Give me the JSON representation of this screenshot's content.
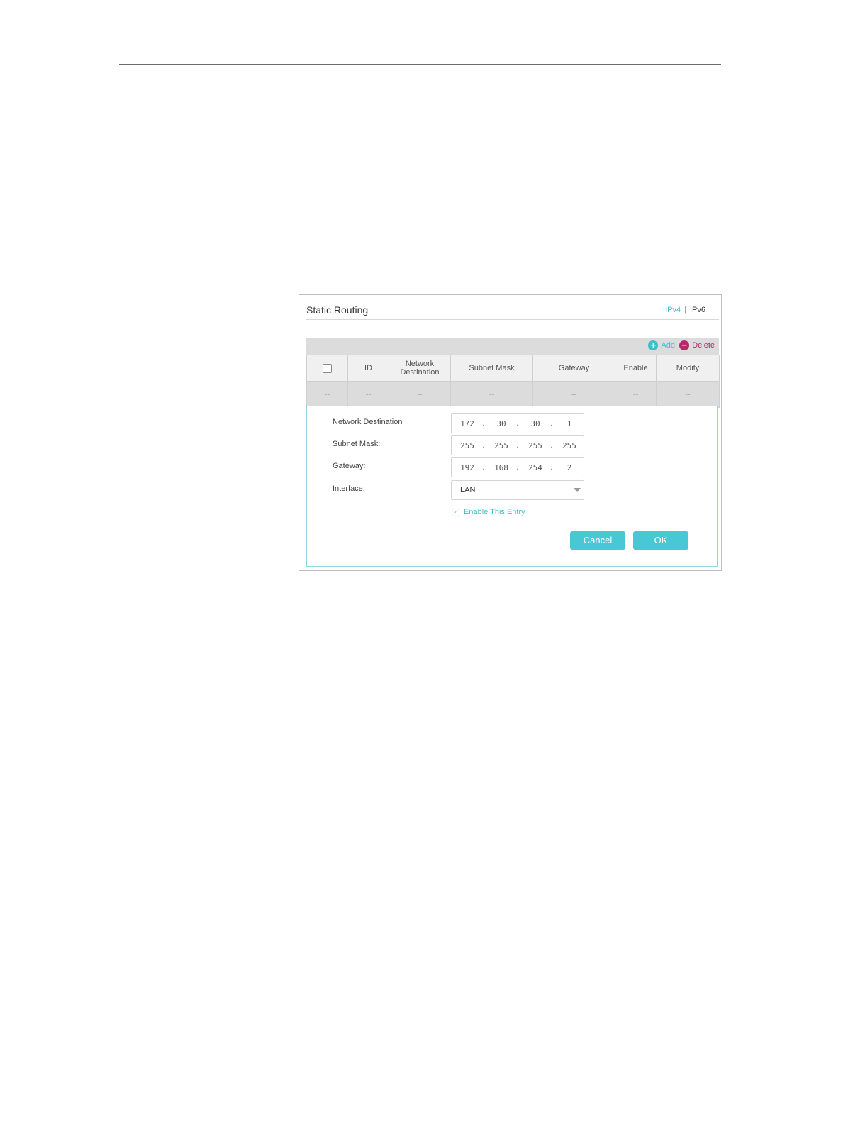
{
  "panel": {
    "title": "Static Routing",
    "tabs": {
      "ipv4": "IPv4",
      "separator": "|",
      "ipv6": "IPv6"
    },
    "toolbar": {
      "add_label": "Add",
      "delete_label": "Delete"
    },
    "table": {
      "columns": [
        "ID",
        "Network Destination",
        "Subnet Mask",
        "Gateway",
        "Enable",
        "Modify"
      ],
      "empty_row": [
        "--",
        "--",
        "--",
        "--",
        "--",
        "--",
        "--"
      ]
    },
    "form": {
      "network_destination": {
        "label": "Network Destination",
        "octets": [
          "172",
          "30",
          "30",
          "1"
        ]
      },
      "subnet_mask": {
        "label": "Subnet Mask:",
        "octets": [
          "255",
          "255",
          "255",
          "255"
        ]
      },
      "gateway": {
        "label": "Gateway:",
        "octets": [
          "192",
          "168",
          "254",
          "2"
        ]
      },
      "interface": {
        "label": "Interface:",
        "value": "LAN"
      },
      "enable_entry": {
        "label": "Enable This Entry",
        "checked": true
      }
    },
    "buttons": {
      "cancel": "Cancel",
      "ok": "OK"
    },
    "colors": {
      "accent": "#48c7d4",
      "delete": "#b5296b"
    },
    "icons": {
      "add": "add-circle-icon",
      "delete": "remove-circle-icon",
      "checkbox": "checkbox-icon",
      "dropdown": "chevron-down-icon"
    }
  }
}
